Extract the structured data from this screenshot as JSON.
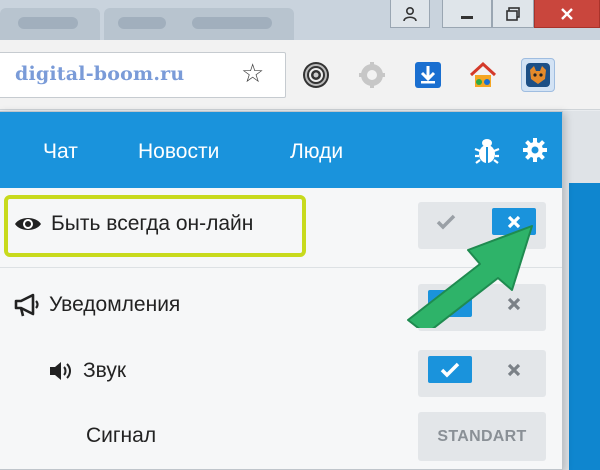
{
  "toolbar": {
    "url": "digital-boom.ru"
  },
  "extensions": [
    "opera-icon",
    "gear-addon-icon",
    "download-icon",
    "house-icon",
    "fox-icon"
  ],
  "nav": {
    "items": [
      "Чат",
      "Новости",
      "Люди"
    ]
  },
  "settings": {
    "always_online": {
      "label": "Быть всегда он-лайн",
      "enabled": false
    },
    "notifications": {
      "label": "Уведомления",
      "enabled": true
    },
    "sound": {
      "label": "Звук",
      "enabled": true
    },
    "signal": {
      "label": "Сигнал",
      "value": "STANDART"
    }
  },
  "colors": {
    "accent": "#1a93dc",
    "highlight": "#c8da1d",
    "arrow": "#2eb369"
  }
}
